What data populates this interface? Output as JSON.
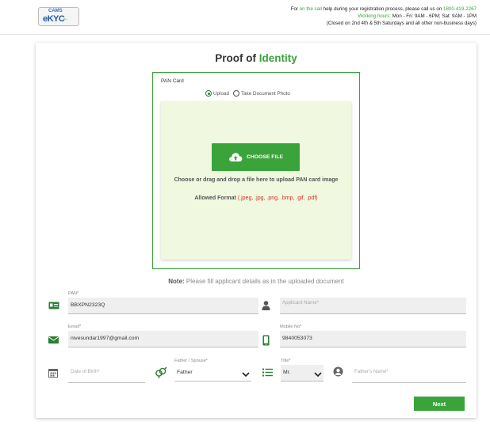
{
  "header": {
    "logo_top": "CAMS",
    "logo_main": "eKYC",
    "contact_line1_pre": "For ",
    "contact_line1_hl": "on the call",
    "contact_line1_post": " help during your registration process, please call us on ",
    "contact_phone": "1800-419-2267",
    "working_hours_label": "Working hours:",
    "working_hours": " Mon - Fri: 9AM - 6PM; Sat: 9AM - 1PM",
    "closed_note": "(Closed on 2nd 4th & 5th Saturdays and all other non-business days)"
  },
  "main": {
    "title_pre": "Proof of ",
    "title_hl": "Identity",
    "pan_card_label": "PAN Card",
    "radio_upload": "Upload",
    "radio_photo": "Take Document Photo",
    "choose_file": "CHOOSE FILE",
    "drop_text": "Choose or drag and drop a file here to upload PAN card image",
    "formats_label": "Allowed Format ",
    "formats_list": "(.jpeg, .jpg, .png, .bmp, .gif, .pdf)",
    "note_label": "Note:",
    "note_text": " Please fill applicant details as in the uploaded document"
  },
  "form": {
    "pan_label": "PAN*",
    "pan_value": "BBXPN2323Q",
    "applicant_name_placeholder": "Applicant Name*",
    "email_label": "Email*",
    "email_value": "nivesundar1997@gmail.com",
    "mobile_label": "Mobile No*",
    "mobile_value": "9840053073",
    "dob_placeholder": "Date of Birth*",
    "father_spouse_label": "Father / Spouse*",
    "father_spouse_value": "Father",
    "title_label": "Title*",
    "title_value": "Mr.",
    "fathers_name_placeholder": "Father's Name*"
  },
  "actions": {
    "next": "Next"
  },
  "colors": {
    "accent": "#3aa43a",
    "icon": "#2e7d32"
  }
}
